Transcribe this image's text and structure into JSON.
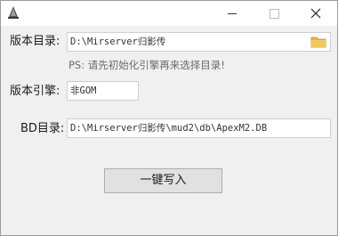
{
  "window": {
    "title": ""
  },
  "titlebar": {
    "icons": {
      "app": "app-logo-icon",
      "minimize": "minimize-icon",
      "maximize": "maximize-icon",
      "close": "close-icon"
    }
  },
  "form": {
    "version_dir": {
      "label": "版本目录:",
      "value": "D:\\Mirserver归影传",
      "browse_icon": "folder-icon"
    },
    "hint": "PS: 请先初始化引擎再来选择目录!",
    "engine": {
      "label": "版本引擎:",
      "value": "非GOM"
    },
    "db_dir": {
      "label": "BD目录:",
      "value": "D:\\Mirserver归影传\\mud2\\db\\ApexM2.DB"
    },
    "write_button": "一键写入"
  },
  "colors": {
    "folder": "#e8b33f",
    "button_bg": "#e1e1e1",
    "field_border": "#cfcfcf"
  }
}
